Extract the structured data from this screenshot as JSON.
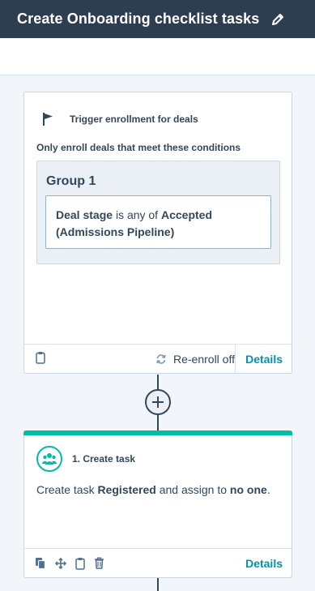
{
  "header": {
    "title": "Create Onboarding checklist tasks",
    "edit_icon": "pencil-icon"
  },
  "trigger": {
    "icon": "flag-icon",
    "label": "Trigger enrollment for deals",
    "conditions_label": "Only enroll deals that meet these conditions",
    "group": {
      "title": "Group 1",
      "condition": {
        "property": "Deal stage",
        "operator": "is any of",
        "value": "Accepted (Admissions Pipeline)"
      }
    },
    "footer": {
      "delete_icon": "clipboard-icon",
      "reenroll_icon": "refresh-icon",
      "reenroll_label": "Re-enroll off",
      "details_label": "Details"
    }
  },
  "connector": {
    "add_icon": "plus-icon"
  },
  "action": {
    "icon": "users-icon",
    "title": "1. Create task",
    "description": {
      "prefix": "Create task",
      "task_name": "Registered",
      "middle": "and assign to",
      "assignee": "no one",
      "suffix": "."
    },
    "footer": {
      "icons": [
        "copy-icon",
        "move-icon",
        "clipboard-icon",
        "trash-icon"
      ],
      "details_label": "Details"
    }
  },
  "colors": {
    "header_bg": "#2d3e50",
    "accent_teal": "#00bda5",
    "link": "#0091ae",
    "text": "#33475b"
  }
}
